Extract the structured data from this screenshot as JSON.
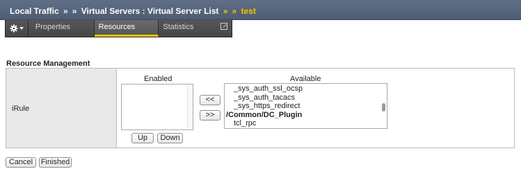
{
  "breadcrumb": {
    "items": [
      "Local Traffic",
      "Virtual Servers : Virtual Server List"
    ],
    "separator": "»",
    "current": "test"
  },
  "tabs": [
    {
      "label": "Properties",
      "selected": false
    },
    {
      "label": "Resources",
      "selected": true
    },
    {
      "label": "Statistics",
      "selected": false
    }
  ],
  "section": {
    "title": "Resource Management",
    "row_label": "iRule",
    "enabled_header": "Enabled",
    "available_header": "Available",
    "enabled_items": [],
    "available_items": [
      {
        "text": "_sys_auth_ssl_ocsp",
        "group": false
      },
      {
        "text": "_sys_auth_tacacs",
        "group": false
      },
      {
        "text": "_sys_https_redirect",
        "group": false
      },
      {
        "text": "/Common/DC_Plugin",
        "group": true
      },
      {
        "text": "tcl_rpc",
        "group": false
      }
    ],
    "add_label": "<<",
    "remove_label": ">>",
    "up_label": "Up",
    "down_label": "Down"
  },
  "actions": {
    "cancel_label": "Cancel",
    "finished_label": "Finished"
  },
  "colors": {
    "titlebar": "#56667c",
    "breadcrumb_current": "#f5c400",
    "tab_bar": "#3e3e3e",
    "selected_tab_underline": "#f5c400"
  },
  "icons": {
    "tab_menu": "gear-icon",
    "tab_menu_arrow": "chevron-down-icon",
    "statistics_popout": "popout-icon"
  }
}
